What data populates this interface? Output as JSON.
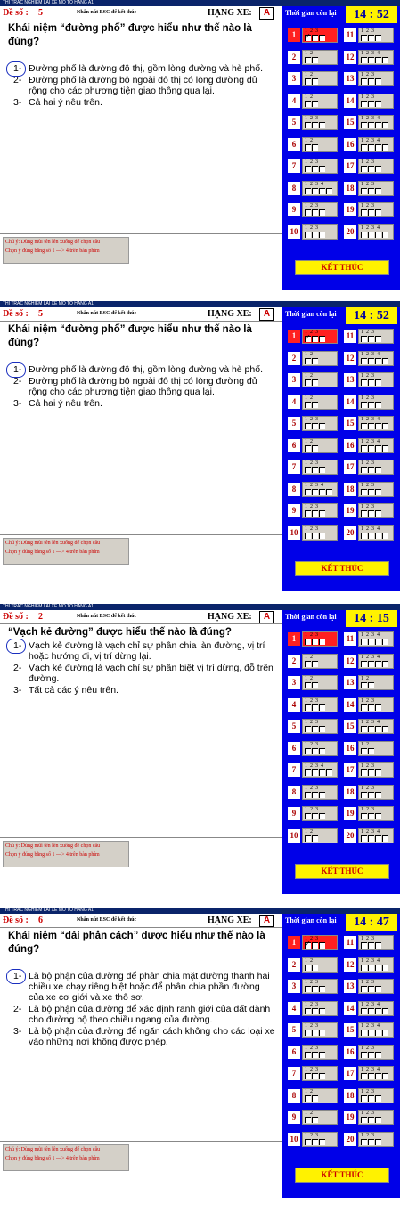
{
  "screens": [
    {
      "title": "THI TRAC NGHIEM LAI XE  MO TO  HANG A1",
      "de_so_label": "Đề số :",
      "de_so": "5",
      "esc_hint": "Nhấn nút ESC để kết thúc",
      "hang_xe_label": "HẠNG XE:",
      "hang_xe": "A",
      "timer_label": "Thời gian còn lại",
      "timer": "14 : 52",
      "question": "Khái niệm “đường phố” được hiểu như thế nào là đúng?",
      "answers": [
        {
          "num": "1-",
          "text": "Đường phố là đường đô thị, gồm lòng đường và hè phố.",
          "selected": true
        },
        {
          "num": "2-",
          "text": "Đường phố là đường bộ ngoài đô thị có lòng đường đủ rộng cho các phương tiện giao thông qua lại.",
          "selected": false
        },
        {
          "num": "3-",
          "text": "Cả hai ý nêu trên.",
          "selected": false
        }
      ],
      "note_1": "Chú ý: Dùng mũi tên lên xuống để chọn câu",
      "note_2": "Chọn ý đúng bằng số 1 ---> 4 trên bàn phím",
      "finish_label": "KẾT THÚC",
      "current": 1,
      "checked": {
        "1": 1
      },
      "grid": [
        3,
        2,
        2,
        2,
        3,
        2,
        3,
        4,
        3,
        3,
        3,
        4,
        3,
        3,
        4,
        4,
        3,
        3,
        3,
        4
      ]
    },
    {
      "title": "THI TRAC NGHIEM LAI XE  MO TO  HANG A1",
      "de_so_label": "Đề số :",
      "de_so": "5",
      "esc_hint": "Nhấn nút ESC để kết thúc",
      "hang_xe_label": "HẠNG XE:",
      "hang_xe": "A",
      "timer_label": "Thời gian còn lại",
      "timer": "14 : 52",
      "question": "Khái niệm “đường phố” được hiểu như thế nào là đúng?",
      "answers": [
        {
          "num": "1-",
          "text": "Đường phố là đường đô thị, gồm lòng đường và hè phố.",
          "selected": true
        },
        {
          "num": "2-",
          "text": "Đường phố là đường bộ ngoài đô thị có lòng đường đủ rộng cho các phương tiện giao thông qua lại.",
          "selected": false
        },
        {
          "num": "3-",
          "text": "Cả hai ý nêu trên.",
          "selected": false
        }
      ],
      "note_1": "Chú ý: Dùng mũi tên lên xuống để chọn câu",
      "note_2": "Chọn ý đúng bằng số 1 ---> 4 trên bàn phím",
      "finish_label": "KẾT THÚC",
      "current": 1,
      "checked": {
        "1": 1
      },
      "grid": [
        3,
        2,
        2,
        2,
        3,
        2,
        3,
        4,
        3,
        3,
        3,
        4,
        3,
        3,
        4,
        4,
        3,
        3,
        3,
        4
      ]
    },
    {
      "title": "THI TRAC NGHIEM LAI XE  MO TO  HANG A1",
      "de_so_label": "Đề số :",
      "de_so": "2",
      "esc_hint": "Nhấn nút ESC để kết thúc",
      "hang_xe_label": "HẠNG XE:",
      "hang_xe": "A",
      "timer_label": "Thời gian còn lại",
      "timer": "14 : 15",
      "question": "“Vạch kẻ đường” được hiểu thế nào là đúng?",
      "answers": [
        {
          "num": "1-",
          "text": "Vạch kẻ đường là vạch chỉ sự phân chia làn đường, vị trí hoặc hướng đi, vị trí dừng lại.",
          "selected": true
        },
        {
          "num": "2-",
          "text": "Vạch kẻ đường là vạch chỉ sự phân biệt vị trí dừng, đỗ trên đường.",
          "selected": false
        },
        {
          "num": "3-",
          "text": "Tất cả các ý nêu trên.",
          "selected": false
        }
      ],
      "note_1": "Chú ý: Dùng mũi tên lên xuống để chọn câu",
      "note_2": "Chọn ý đúng bằng số 1 ---> 4 trên bàn phím",
      "finish_label": "KẾT THÚC",
      "current": 1,
      "checked": {},
      "grid": [
        3,
        2,
        2,
        3,
        3,
        3,
        4,
        3,
        3,
        2,
        4,
        4,
        2,
        3,
        4,
        2,
        3,
        3,
        3,
        4
      ]
    },
    {
      "title": "THI TRAC NGHIEM LAI XE  MO TO  HANG A1",
      "de_so_label": "Đề số :",
      "de_so": "6",
      "esc_hint": "Nhấn nút ESC để kết thúc",
      "hang_xe_label": "HẠNG XE:",
      "hang_xe": "A",
      "timer_label": "Thời gian còn lại",
      "timer": "14 : 47",
      "question": "Khái niệm “dải phân cách” được hiểu như thế nào là đúng?",
      "answers": [
        {
          "num": "1-",
          "text": "Là bộ phận của đường để phân chia mặt đường thành hai chiều xe chạy riêng biệt hoặc để phân chia phần đường của xe cơ giới và xe thô sơ.",
          "selected": true
        },
        {
          "num": "2-",
          "text": "Là bộ phận của đường để xác định ranh giới của đất dành cho đường bộ theo chiều ngang của đường.",
          "selected": false
        },
        {
          "num": "3-",
          "text": "Là bộ phận của đường để ngăn cách không cho các loại xe vào những nơi không được phép.",
          "selected": false
        }
      ],
      "note_1": "Chú ý: Dùng mũi tên lên xuống để chọn câu",
      "note_2": "Chọn ý đúng bằng số 1 ---> 4 trên bàn phím",
      "finish_label": "KẾT THÚC",
      "current": 1,
      "checked": {
        "1": 1
      },
      "grid": [
        3,
        2,
        3,
        3,
        3,
        3,
        3,
        2,
        2,
        3,
        3,
        4,
        3,
        4,
        4,
        3,
        4,
        3,
        3,
        3
      ]
    }
  ]
}
